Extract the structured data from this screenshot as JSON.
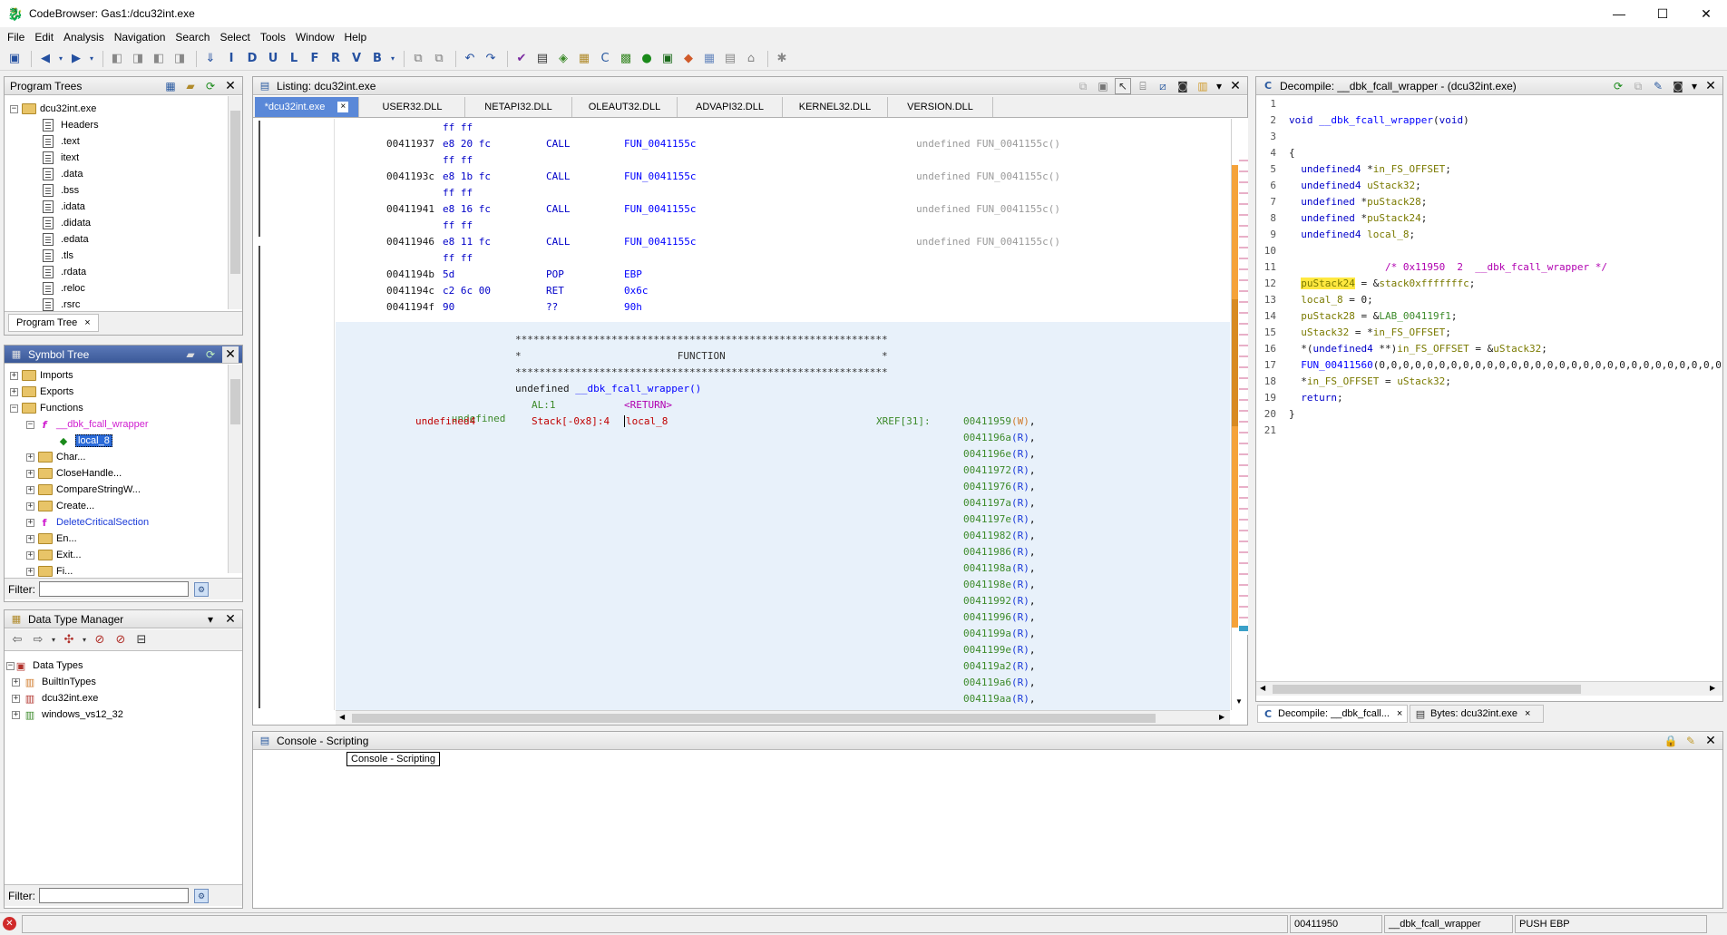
{
  "window": {
    "title": "CodeBrowser: Gas1:/dcu32int.exe",
    "min": "—",
    "max": "☐",
    "close": "✕"
  },
  "menu": [
    "File",
    "Edit",
    "Analysis",
    "Navigation",
    "Search",
    "Select",
    "Tools",
    "Window",
    "Help"
  ],
  "program_trees": {
    "title": "Program Trees",
    "root": "dcu32int.exe",
    "items": [
      "Headers",
      ".text",
      "itext",
      ".data",
      ".bss",
      ".idata",
      ".didata",
      ".edata",
      ".tls",
      ".rdata",
      ".reloc",
      ".rsrc"
    ],
    "tab": "Program Tree",
    "tab_close": "×"
  },
  "symbol_tree": {
    "title": "Symbol Tree",
    "items": [
      {
        "label": "Imports"
      },
      {
        "label": "Exports"
      },
      {
        "label": "Functions"
      },
      {
        "label": "__dbk_fcall_wrapper"
      },
      {
        "label": "local_8"
      },
      {
        "label": "Char..."
      },
      {
        "label": "CloseHandle..."
      },
      {
        "label": "CompareStringW..."
      },
      {
        "label": "Create..."
      },
      {
        "label": "DeleteCriticalSection"
      },
      {
        "label": "En..."
      },
      {
        "label": "Exit..."
      },
      {
        "label": "Fi..."
      }
    ],
    "filter_label": "Filter:"
  },
  "dtm": {
    "title": "Data Type Manager",
    "items": [
      "Data Types",
      "BuiltInTypes",
      "dcu32int.exe",
      "windows_vs12_32"
    ],
    "filter_label": "Filter:"
  },
  "listing": {
    "title": "Listing:  dcu32int.exe",
    "tabs": [
      "*dcu32int.exe",
      "USER32.DLL",
      "NETAPI32.DLL",
      "OLEAUT32.DLL",
      "ADVAPI32.DLL",
      "KERNEL32.DLL",
      "VERSION.DLL"
    ],
    "tab_close": "×",
    "code": [
      {
        "addr": "",
        "bytes": "ff ff",
        "mn": "",
        "op": "",
        "cm": ""
      },
      {
        "addr": "00411937",
        "bytes": "e8 20 fc",
        "mn": "CALL",
        "op": "FUN_0041155c",
        "cm": "undefined FUN_0041155c()"
      },
      {
        "addr": "",
        "bytes": "ff ff",
        "mn": "",
        "op": "",
        "cm": ""
      },
      {
        "addr": "0041193c",
        "bytes": "e8 1b fc",
        "mn": "CALL",
        "op": "FUN_0041155c",
        "cm": "undefined FUN_0041155c()"
      },
      {
        "addr": "",
        "bytes": "ff ff",
        "mn": "",
        "op": "",
        "cm": ""
      },
      {
        "addr": "00411941",
        "bytes": "e8 16 fc",
        "mn": "CALL",
        "op": "FUN_0041155c",
        "cm": "undefined FUN_0041155c()"
      },
      {
        "addr": "",
        "bytes": "ff ff",
        "mn": "",
        "op": "",
        "cm": ""
      },
      {
        "addr": "00411946",
        "bytes": "e8 11 fc",
        "mn": "CALL",
        "op": "FUN_0041155c",
        "cm": "undefined FUN_0041155c()"
      },
      {
        "addr": "",
        "bytes": "ff ff",
        "mn": "",
        "op": "",
        "cm": ""
      },
      {
        "addr": "0041194b",
        "bytes": "5d",
        "mn": "POP",
        "op": "EBP",
        "cm": ""
      },
      {
        "addr": "0041194c",
        "bytes": "c2 6c 00",
        "mn": "RET",
        "op": "0x6c",
        "cm": ""
      },
      {
        "addr": "0041194f",
        "bytes": "90",
        "mn": "??",
        "op": "90h",
        "cm": ""
      }
    ],
    "stars": "**************************************************************",
    "func_banner": "*                          FUNCTION                          *",
    "func_sig_type": "undefined",
    "func_sig_name": "__dbk_fcall_wrapper()",
    "ret_type": "undefined",
    "ret_loc": "AL:1",
    "ret_name": "<RETURN>",
    "var_type": "undefined4",
    "var_loc": "Stack[-0x8]:4",
    "var_name": "local_8",
    "xref_label": "XREF[31]:",
    "xrefs": [
      {
        "a": "00411959",
        "t": "(W)"
      },
      {
        "a": "0041196a",
        "t": "(R)"
      },
      {
        "a": "0041196e",
        "t": "(R)"
      },
      {
        "a": "00411972",
        "t": "(R)"
      },
      {
        "a": "00411976",
        "t": "(R)"
      },
      {
        "a": "0041197a",
        "t": "(R)"
      },
      {
        "a": "0041197e",
        "t": "(R)"
      },
      {
        "a": "00411982",
        "t": "(R)"
      },
      {
        "a": "00411986",
        "t": "(R)"
      },
      {
        "a": "0041198a",
        "t": "(R)"
      },
      {
        "a": "0041198e",
        "t": "(R)"
      },
      {
        "a": "00411992",
        "t": "(R)"
      },
      {
        "a": "00411996",
        "t": "(R)"
      },
      {
        "a": "0041199a",
        "t": "(R)"
      },
      {
        "a": "0041199e",
        "t": "(R)"
      },
      {
        "a": "004119a2",
        "t": "(R)"
      },
      {
        "a": "004119a6",
        "t": "(R)"
      },
      {
        "a": "004119aa",
        "t": "(R)"
      }
    ]
  },
  "decompile": {
    "title": "Decompile: __dbk_fcall_wrapper - (dcu32int.exe)",
    "lines": [
      [],
      [
        [
          "kw",
          "void "
        ],
        [
          "fn",
          "__dbk_fcall_wrapper"
        ],
        [
          "dk",
          "("
        ],
        [
          "kw",
          "void"
        ],
        [
          "dk",
          ")"
        ]
      ],
      [],
      [
        [
          "dk",
          "{"
        ]
      ],
      [
        [
          "kw",
          "  undefined4 "
        ],
        [
          "dk",
          "*"
        ],
        [
          "olv",
          "in_FS_OFFSET"
        ],
        [
          "dk",
          ";"
        ]
      ],
      [
        [
          "kw",
          "  undefined4 "
        ],
        [
          "olv",
          "uStack32"
        ],
        [
          "dk",
          ";"
        ]
      ],
      [
        [
          "kw",
          "  undefined "
        ],
        [
          "dk",
          "*"
        ],
        [
          "olv",
          "puStack28"
        ],
        [
          "dk",
          ";"
        ]
      ],
      [
        [
          "kw",
          "  undefined "
        ],
        [
          "dk",
          "*"
        ],
        [
          "olv",
          "puStack24"
        ],
        [
          "dk",
          ";"
        ]
      ],
      [
        [
          "kw",
          "  undefined4 "
        ],
        [
          "olv",
          "local_8"
        ],
        [
          "dk",
          ";"
        ]
      ],
      [],
      [
        [
          "pur",
          "                /* 0x11950  2  __dbk_fcall_wrapper */"
        ]
      ],
      [
        [
          "dk",
          "  "
        ],
        [
          "hl",
          "puStack24"
        ],
        [
          "dk",
          " = &"
        ],
        [
          "olv",
          "stack0xfffffffc"
        ],
        [
          "dk",
          ";"
        ]
      ],
      [
        [
          "olv",
          "  local_8"
        ],
        [
          "dk",
          " = 0;"
        ]
      ],
      [
        [
          "olv",
          "  puStack28"
        ],
        [
          "dk",
          " = &"
        ],
        [
          "grn",
          "LAB_004119f1"
        ],
        [
          "dk",
          ";"
        ]
      ],
      [
        [
          "olv",
          "  uStack32"
        ],
        [
          "dk",
          " = *"
        ],
        [
          "olv",
          "in_FS_OFFSET"
        ],
        [
          "dk",
          ";"
        ]
      ],
      [
        [
          "dk",
          "  *("
        ],
        [
          "kw",
          "undefined4"
        ],
        [
          "dk",
          " **)"
        ],
        [
          "olv",
          "in_FS_OFFSET"
        ],
        [
          "dk",
          " = &"
        ],
        [
          "olv",
          "uStack32"
        ],
        [
          "dk",
          ";"
        ]
      ],
      [
        [
          "fn",
          "  FUN_00411560"
        ],
        [
          "dk",
          "(0,0,0,0,0,0,0,0,0,0,0,0,0,0,0,0,0,0,0,0,0,0,0,0,0,0,0,0,0,0,0,0"
        ]
      ],
      [
        [
          "dk",
          "  *"
        ],
        [
          "olv",
          "in_FS_OFFSET"
        ],
        [
          "dk",
          " = "
        ],
        [
          "olv",
          "uStack32"
        ],
        [
          "dk",
          ";"
        ]
      ],
      [
        [
          "kw",
          "  return"
        ],
        [
          "dk",
          ";"
        ]
      ],
      [
        [
          "dk",
          "}"
        ]
      ],
      []
    ],
    "tabs": [
      {
        "label": "Decompile: __dbk_fcall...",
        "close": "×"
      },
      {
        "label": "Bytes: dcu32int.exe",
        "close": "×"
      }
    ]
  },
  "console": {
    "title": "Console - Scripting",
    "tooltip": "Console - Scripting"
  },
  "status": {
    "addr": "00411950",
    "func": "__dbk_fcall_wrapper",
    "instr": "PUSH EBP"
  }
}
